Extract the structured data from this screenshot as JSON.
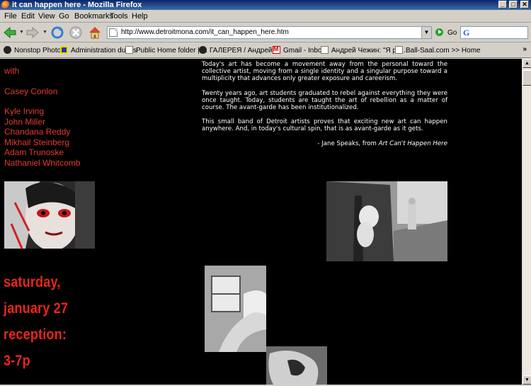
{
  "window": {
    "title": "it can happen here - Mozilla Firefox",
    "minimize": "_",
    "maximize": "□",
    "close": "✕"
  },
  "menu": [
    "File",
    "Edit",
    "View",
    "Go",
    "Bookmarks",
    "Tools",
    "Help"
  ],
  "navbar": {
    "url": "http://www.detroitmona.com/it_can_happen_here.htm",
    "go_label": "Go"
  },
  "bookmarks": [
    {
      "label": "Nonstop Photos",
      "icon": "nonstop-icon"
    },
    {
      "label": "Administration duties",
      "icon": "admin-icon"
    },
    {
      "label": "Public Home folder | ...",
      "icon": "page-icon"
    },
    {
      "label": "ГАЛЕРЕЯ / Андрей ...",
      "icon": "nonstop-icon"
    },
    {
      "label": "Gmail - Inbox",
      "icon": "gmail-icon"
    },
    {
      "label": "Андрей Чежин: \"Я рк...",
      "icon": "page-icon"
    },
    {
      "label": "Ball-Saal.com >> Home",
      "icon": "page-icon"
    }
  ],
  "bookmarks_more": "»",
  "page": {
    "artists_intro": "with",
    "curator": "Casey Conlon",
    "artists": [
      "Kyle Irving",
      "John Miller",
      "Chandana Reddy",
      "Mikhail Steinberg",
      "Adam Trunoske",
      "Nathaniel Whitcomb"
    ],
    "essay": [
      "Today's art has become a movement away from the personal toward the collective artist, moving from a single identity and a singular purpose toward a multiplicity that advances only greater exposure and careerism.",
      "Twenty years ago, art students graduated to rebel against everything they were once taught. Today, students are taught the art of rebellion as a matter of course. The avant-garde has been institutionalized.",
      "This small band of Detroit artists proves that exciting new art can happen anywhere. And, in today's cultural spin, that is as avant-garde as it gets."
    ],
    "signature_prefix": "- Jane Speaks, from ",
    "signature_title": "Art Can't Happen Here",
    "event": [
      "saturday,",
      "january 27",
      "reception:",
      "3-7p"
    ]
  },
  "colors": {
    "accent_red": "#e23a2e",
    "background": "#000000"
  }
}
